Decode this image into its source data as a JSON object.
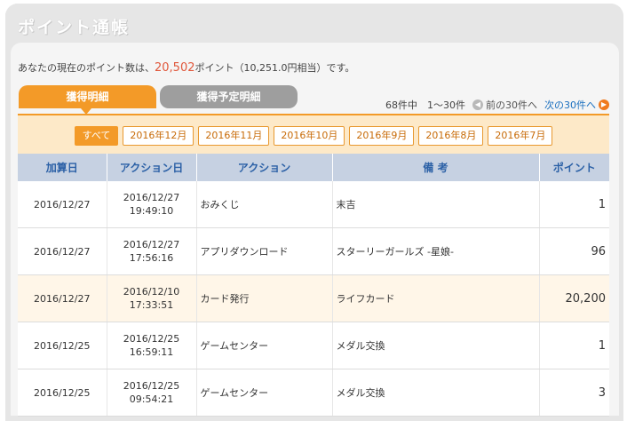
{
  "page_title": "ポイント通帳",
  "balance": {
    "prefix": "あなたの現在のポイント数は、",
    "points": "20,502",
    "suffix": "ポイント（10,251.0円相当）です。"
  },
  "tabs": [
    {
      "label": "獲得明細",
      "active": true
    },
    {
      "label": "獲得予定明細",
      "active": false
    }
  ],
  "pager": {
    "summary": "68件中　1～30件",
    "prev_label": "前の30件へ",
    "next_label": "次の30件へ"
  },
  "filters": [
    "すべて",
    "2016年12月",
    "2016年11月",
    "2016年10月",
    "2016年9月",
    "2016年8月",
    "2016年7月"
  ],
  "table": {
    "headers": [
      "加算日",
      "アクション日",
      "アクション",
      "備 考",
      "ポイント"
    ],
    "rows": [
      {
        "added": "2016/12/27",
        "action_date": "2016/12/27",
        "action_time": "19:49:10",
        "action": "おみくじ",
        "note": "末吉",
        "points": "1"
      },
      {
        "added": "2016/12/27",
        "action_date": "2016/12/27",
        "action_time": "17:56:16",
        "action": "アプリダウンロード",
        "note": "スターリーガールズ -星娘-",
        "points": "96"
      },
      {
        "added": "2016/12/27",
        "action_date": "2016/12/10",
        "action_time": "17:33:51",
        "action": "カード発行",
        "note": "ライフカード",
        "points": "20,200"
      },
      {
        "added": "2016/12/25",
        "action_date": "2016/12/25",
        "action_time": "16:59:11",
        "action": "ゲームセンター",
        "note": "メダル交換",
        "points": "1"
      },
      {
        "added": "2016/12/25",
        "action_date": "2016/12/25",
        "action_time": "09:54:21",
        "action": "ゲームセンター",
        "note": "メダル交換",
        "points": "3"
      }
    ]
  },
  "colors": {
    "accent": "#f39a28",
    "points_red": "#e0573b",
    "header_blue": "#c6d1e2",
    "link_blue": "#1a6fbf"
  }
}
